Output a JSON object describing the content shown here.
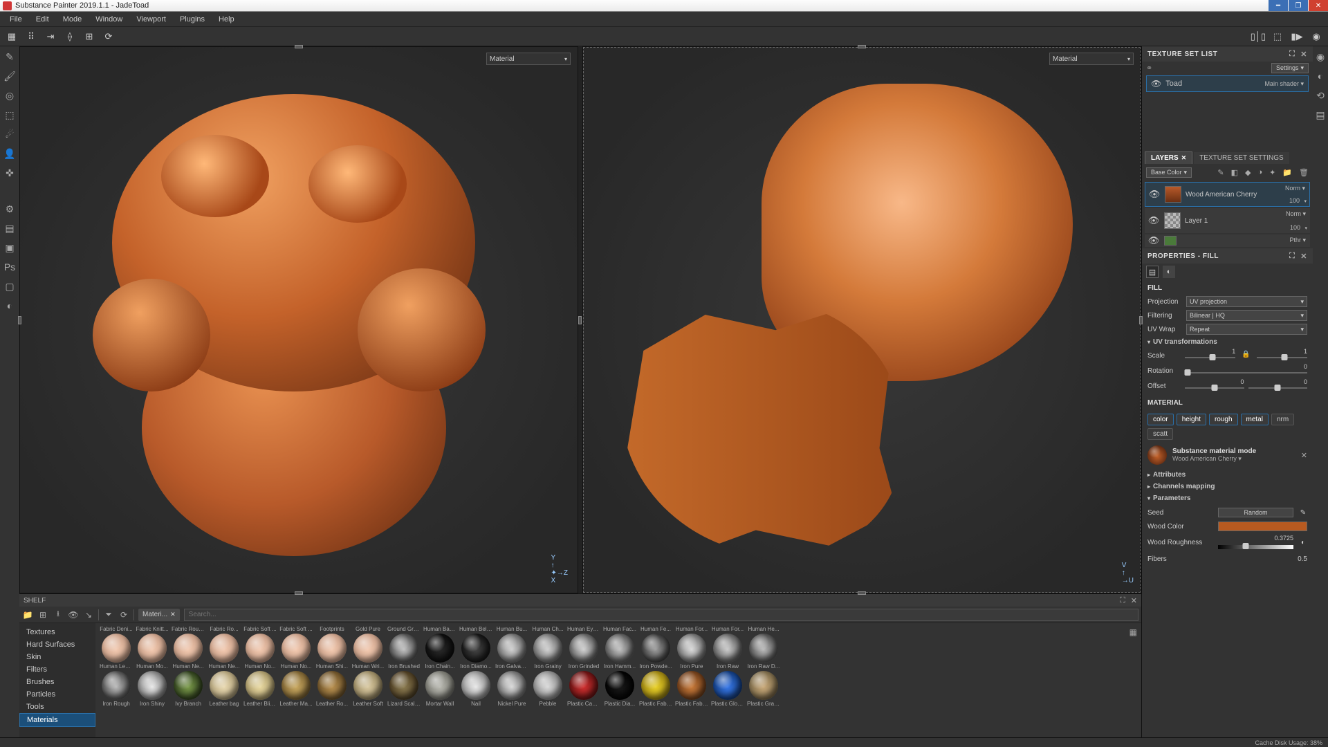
{
  "window": {
    "title": "Substance Painter 2019.1.1 - JadeToad"
  },
  "menu": [
    "File",
    "Edit",
    "Mode",
    "Window",
    "Viewport",
    "Plugins",
    "Help"
  ],
  "viewport_mode_label": "Material",
  "shelf": {
    "title": "SHELF",
    "chip": "Materi...",
    "search_placeholder": "Search...",
    "categories": [
      "Textures",
      "Hard Surfaces",
      "Skin",
      "Filters",
      "Brushes",
      "Particles",
      "Tools",
      "Materials"
    ],
    "active_category": "Materials",
    "row1_labels": [
      "Fabric Deni...",
      "Fabric Knitt...",
      "Fabric Rough",
      "Fabric Ro...",
      "Fabric Soft ...",
      "Fabric Soft ...",
      "Footprints",
      "Gold Pure",
      "Ground Gra...",
      "Human Bac...",
      "Human Bell...",
      "Human Bu...",
      "Human Ch...",
      "Human Eye...",
      "Human Fac...",
      "Human Fe...",
      "Human For...",
      "Human For...",
      "Human He..."
    ],
    "row2": [
      {
        "label": "Human Leg...",
        "c1": "#f2c9b0",
        "c2": "#caa088"
      },
      {
        "label": "Human Mo...",
        "c1": "#f2c9b0",
        "c2": "#caa088"
      },
      {
        "label": "Human Ne...",
        "c1": "#f2c9b0",
        "c2": "#caa088"
      },
      {
        "label": "Human Ne...",
        "c1": "#f2c9b0",
        "c2": "#caa088"
      },
      {
        "label": "Human No...",
        "c1": "#f2c9b0",
        "c2": "#caa088"
      },
      {
        "label": "Human No...",
        "c1": "#f2c9b0",
        "c2": "#caa088"
      },
      {
        "label": "Human Shi...",
        "c1": "#f2c9b0",
        "c2": "#caa088"
      },
      {
        "label": "Human Wri...",
        "c1": "#f2c9b0",
        "c2": "#caa088"
      },
      {
        "label": "Iron Brushed",
        "c1": "#bfbfbf",
        "c2": "#4a4a4a"
      },
      {
        "label": "Iron Chain...",
        "c1": "#2a2a2a",
        "c2": "#0a0a0a"
      },
      {
        "label": "Iron Diamo...",
        "c1": "#444",
        "c2": "#111"
      },
      {
        "label": "Iron Galvan...",
        "c1": "#cfcfcf",
        "c2": "#6a6a6a"
      },
      {
        "label": "Iron Grainy",
        "c1": "#cfcfcf",
        "c2": "#6a6a6a"
      },
      {
        "label": "Iron Grinded",
        "c1": "#cfcfcf",
        "c2": "#5a5a5a"
      },
      {
        "label": "Iron Hamm...",
        "c1": "#bfbfbf",
        "c2": "#555"
      },
      {
        "label": "Iron Powde...",
        "c1": "#9a9a9a",
        "c2": "#333"
      },
      {
        "label": "Iron Pure",
        "c1": "#d8d8d8",
        "c2": "#6a6a6a"
      },
      {
        "label": "Iron Raw",
        "c1": "#c8c8c8",
        "c2": "#5a5a5a"
      },
      {
        "label": "Iron Raw D...",
        "c1": "#b8b8b8",
        "c2": "#4a4a4a"
      }
    ],
    "row3": [
      {
        "label": "Iron Rough",
        "c1": "#b8b8b8",
        "c2": "#4a4a4a"
      },
      {
        "label": "Iron Shiny",
        "c1": "#e8e8e8",
        "c2": "#7a7a7a"
      },
      {
        "label": "Ivy Branch",
        "c1": "#7a9a4a",
        "c2": "#2a3a1a"
      },
      {
        "label": "Leather bag",
        "c1": "#e8d8b0",
        "c2": "#b0a078"
      },
      {
        "label": "Leather Blis...",
        "c1": "#e8d8a0",
        "c2": "#a89868"
      },
      {
        "label": "Leather Ma...",
        "c1": "#c8a860",
        "c2": "#7a6030"
      },
      {
        "label": "Leather Ro...",
        "c1": "#b89050",
        "c2": "#6a5028"
      },
      {
        "label": "Leather Soft",
        "c1": "#d8c8a0",
        "c2": "#988860"
      },
      {
        "label": "Lizard Scales",
        "c1": "#8a7a50",
        "c2": "#4a3a20"
      },
      {
        "label": "Mortar Wall",
        "c1": "#b8b8b0",
        "c2": "#787870"
      },
      {
        "label": "Nail",
        "c1": "#e8e8e8",
        "c2": "#888"
      },
      {
        "label": "Nickel Pure",
        "c1": "#d8d8d8",
        "c2": "#6a6a6a"
      },
      {
        "label": "Pebble",
        "c1": "#d8d8d8",
        "c2": "#888"
      },
      {
        "label": "Plastic Cabl...",
        "c1": "#d03030",
        "c2": "#601010"
      },
      {
        "label": "Plastic Dia...",
        "c1": "#1a1a1a",
        "c2": "#000"
      },
      {
        "label": "Plastic Fabr...",
        "c1": "#e8d028",
        "c2": "#988010"
      },
      {
        "label": "Plastic Fabri...",
        "c1": "#c87a3a",
        "c2": "#6a3a18"
      },
      {
        "label": "Plastic Glos...",
        "c1": "#3878e8",
        "c2": "#103878"
      },
      {
        "label": "Plastic Grainy",
        "c1": "#c8a878",
        "c2": "#786848"
      }
    ]
  },
  "texture_set_list": {
    "title": "TEXTURE SET LIST",
    "settings_label": "Settings",
    "item_name": "Toad",
    "shader_label": "Main shader"
  },
  "layers_tabs": {
    "layers": "LAYERS",
    "settings": "TEXTURE SET SETTINGS"
  },
  "layers": {
    "channel_select": "Base Color",
    "items": [
      {
        "name": "Wood American Cherry",
        "blend": "Norm",
        "opacity": "100"
      },
      {
        "name": "Layer 1",
        "blend": "Norm",
        "opacity": "100"
      }
    ],
    "partial_blend": "Pthr"
  },
  "properties": {
    "title": "PROPERTIES - FILL",
    "fill_title": "FILL",
    "projection_label": "Projection",
    "projection_value": "UV projection",
    "filtering_label": "Filtering",
    "filtering_value": "Bilinear | HQ",
    "uvwrap_label": "UV Wrap",
    "uvwrap_value": "Repeat",
    "uv_transform_title": "UV transformations",
    "scale_label": "Scale",
    "scale_values": [
      "1",
      "1"
    ],
    "rotation_label": "Rotation",
    "rotation_value": "0",
    "offset_label": "Offset",
    "offset_values": [
      "0",
      "0"
    ],
    "material_title": "MATERIAL",
    "channels": [
      "color",
      "height",
      "rough",
      "metal",
      "nrm",
      "scatt"
    ],
    "channels_on": [
      "color",
      "height",
      "rough",
      "metal"
    ],
    "mat_mode_title": "Substance material mode",
    "mat_mode_name": "Wood American Cherry",
    "attributes_title": "Attributes",
    "channels_mapping_title": "Channels mapping",
    "parameters_title": "Parameters",
    "seed_label": "Seed",
    "seed_btn": "Random",
    "wood_color_label": "Wood Color",
    "wood_color_hex": "#b85a20",
    "wood_rough_label": "Wood Roughness",
    "wood_rough_value": "0.3725",
    "fibers_label": "Fibers",
    "fibers_value": "0.5"
  },
  "status": {
    "cache": "Cache Disk Usage:  38%"
  }
}
